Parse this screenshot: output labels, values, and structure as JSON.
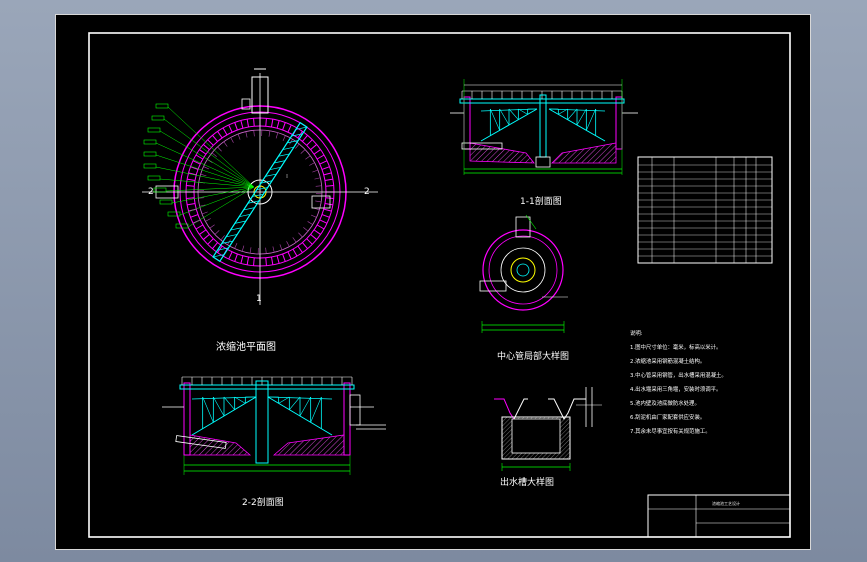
{
  "labels": {
    "plan_title": "浓缩池平面图",
    "section11_title": "1-1剖面图",
    "section22_title": "2-2剖面图",
    "center_pipe_title": "中心管局部大样图",
    "outlet_title": "出水槽大样图",
    "title_block_name": "浓缩池工艺设计",
    "cut_mark_1": "1",
    "cut_mark_2": "2"
  },
  "notes": [
    "说明:",
    "1.图中尺寸单位：毫米，标高以米计。",
    "2.浓缩池采用钢筋混凝土结构。",
    "3.中心管采用钢管，出水槽采用混凝土。",
    "4.出水堰采用三角堰，安装时须调平。",
    "5.池内壁及池底做防水处理。",
    "6.刮泥机由厂家配套供应安装。",
    "7.其余未尽事宜按有关规范施工。"
  ],
  "colors": {
    "concrete": "#ff00ff",
    "bridge": "#00ffff",
    "dimension": "#00ff00",
    "pipe": "#ffff00",
    "outline": "#ffffff",
    "hatch": "#ff55ff"
  }
}
